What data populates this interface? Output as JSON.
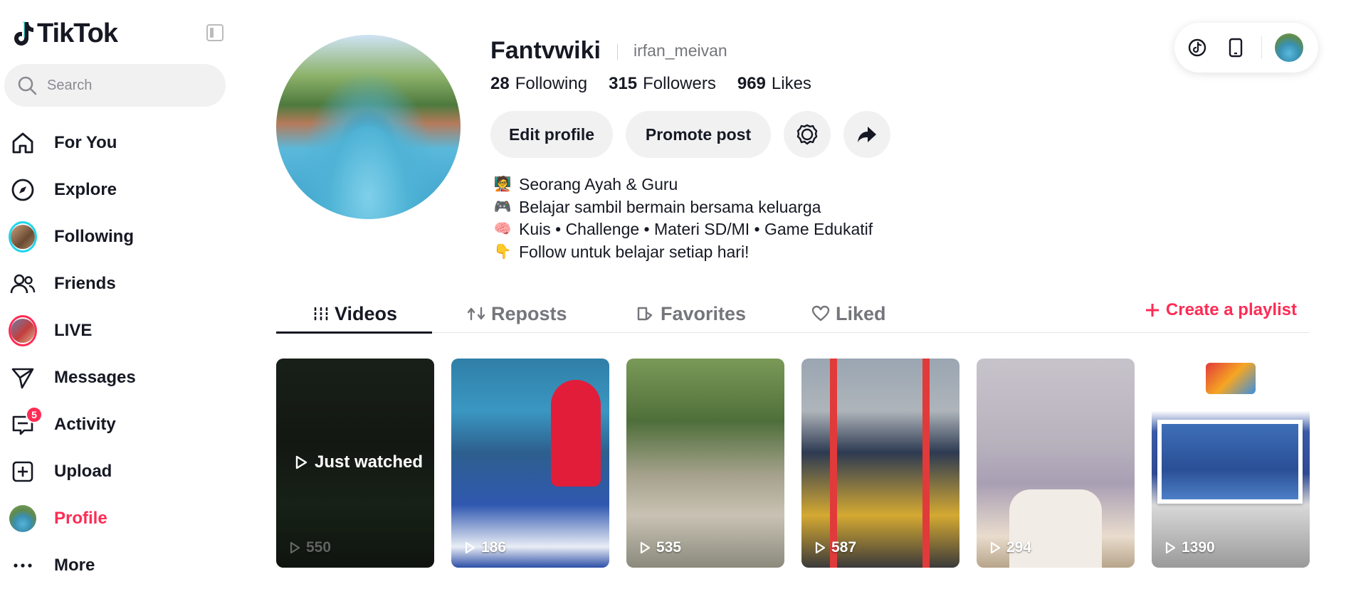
{
  "sidebar": {
    "logo_text": "TikTok",
    "search_placeholder": "Search",
    "items": [
      {
        "label": "For You",
        "icon": "home-icon"
      },
      {
        "label": "Explore",
        "icon": "compass-icon"
      },
      {
        "label": "Following",
        "icon": "following-avatar"
      },
      {
        "label": "Friends",
        "icon": "friends-icon"
      },
      {
        "label": "LIVE",
        "icon": "live-avatar"
      },
      {
        "label": "Messages",
        "icon": "send-icon"
      },
      {
        "label": "Activity",
        "icon": "activity-icon",
        "badge": "5"
      },
      {
        "label": "Upload",
        "icon": "plus-square-icon"
      },
      {
        "label": "Profile",
        "icon": "profile-avatar",
        "active": true
      },
      {
        "label": "More",
        "icon": "more-dots-icon"
      }
    ]
  },
  "profile": {
    "name": "Fantvwiki",
    "handle": "irfan_meivan",
    "stats": [
      {
        "value": "28",
        "label": "Following"
      },
      {
        "value": "315",
        "label": "Followers"
      },
      {
        "value": "969",
        "label": "Likes"
      }
    ],
    "buttons": {
      "edit": "Edit profile",
      "promote": "Promote post"
    },
    "bio": [
      {
        "emoji": "🧑‍🏫",
        "text": "Seorang Ayah & Guru"
      },
      {
        "emoji": "🎮",
        "text": "Belajar sambil bermain bersama keluarga"
      },
      {
        "emoji": "🧠",
        "text": "Kuis • Challenge • Materi SD/MI • Game Edukatif"
      },
      {
        "emoji": "👇",
        "text": "Follow untuk belajar setiap hari!"
      }
    ]
  },
  "tabs": [
    {
      "label": "Videos",
      "icon": "grid-icon",
      "active": true
    },
    {
      "label": "Reposts",
      "icon": "repost-icon"
    },
    {
      "label": "Favorites",
      "icon": "bookmark-icon"
    },
    {
      "label": "Liked",
      "icon": "heart-icon"
    }
  ],
  "create_playlist": "Create a playlist",
  "videos": [
    {
      "views": "550",
      "overlay": "Just watched"
    },
    {
      "views": "186"
    },
    {
      "views": "535"
    },
    {
      "views": "587"
    },
    {
      "views": "294"
    },
    {
      "views": "1390"
    }
  ],
  "colors": {
    "accent": "#fe2c55",
    "text": "#161823",
    "muted": "#75767b",
    "button_bg": "#f1f1f2"
  }
}
